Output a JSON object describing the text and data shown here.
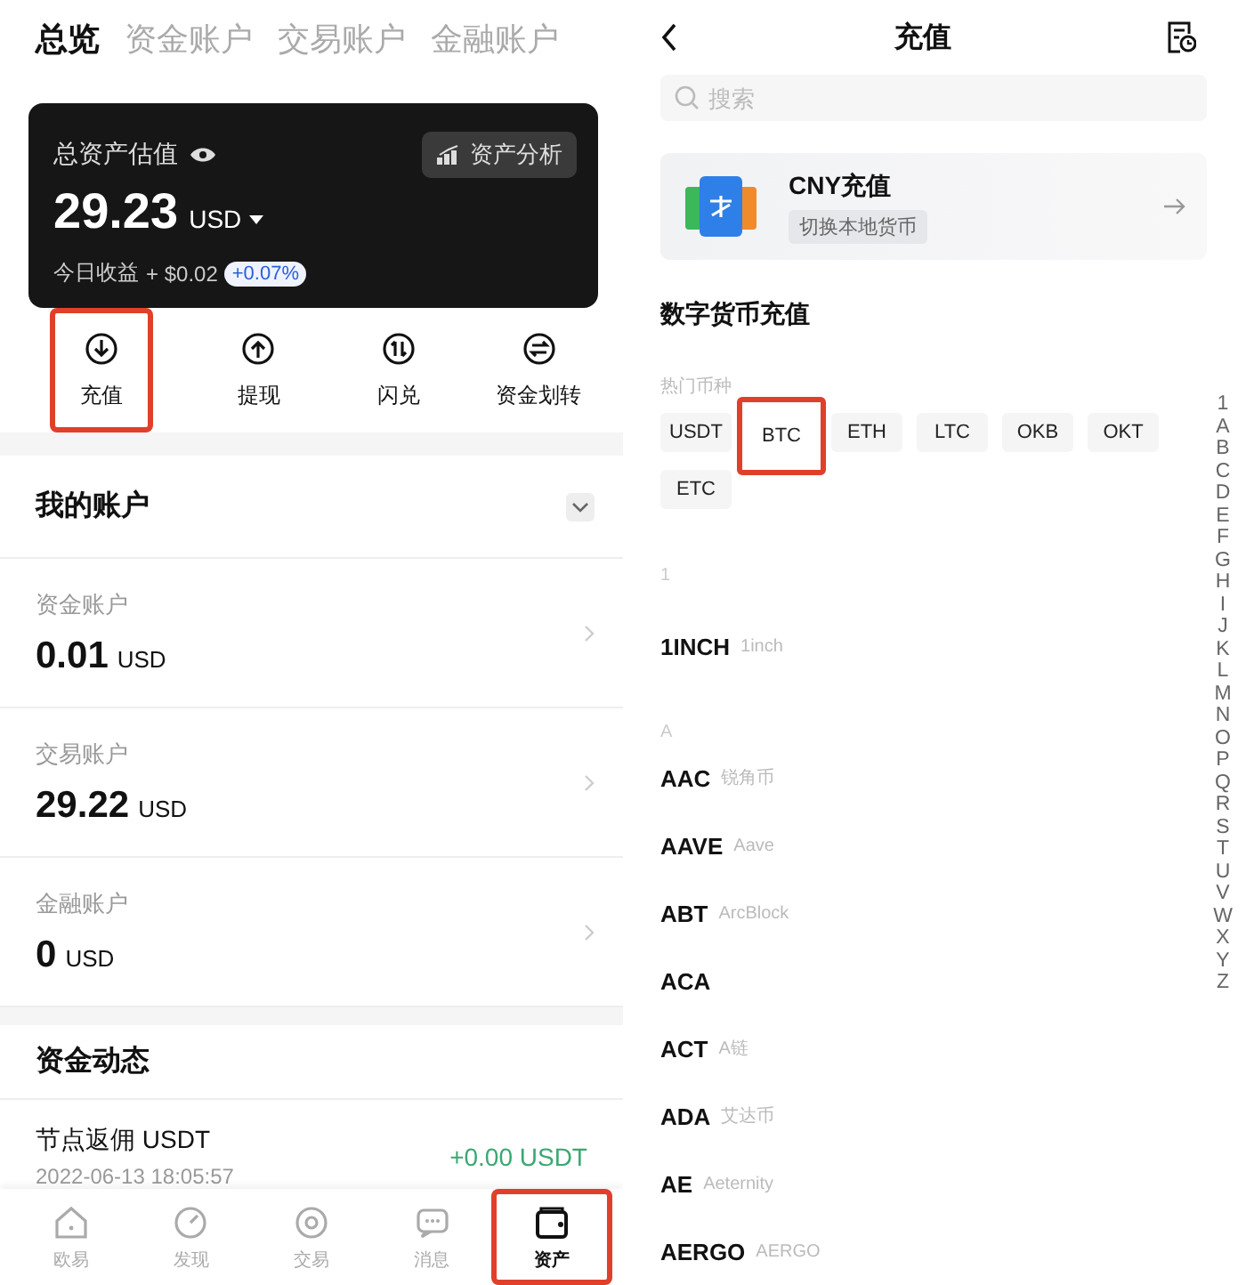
{
  "left": {
    "tabs": [
      {
        "label": "总览",
        "selected": true
      },
      {
        "label": "资金账户",
        "selected": false
      },
      {
        "label": "交易账户",
        "selected": false
      },
      {
        "label": "金融账户",
        "selected": false
      }
    ],
    "asset_card": {
      "title": "总资产估值",
      "value": "29.23",
      "unit": "USD",
      "analysis_button": "资产分析",
      "today_label": "今日收益",
      "today_value": "+ $0.02",
      "today_change": "+0.07%"
    },
    "actions": [
      {
        "label": "充值",
        "kind": "deposit",
        "highlighted": true
      },
      {
        "label": "提现",
        "kind": "withdraw",
        "highlighted": false
      },
      {
        "label": "闪兑",
        "kind": "swap",
        "highlighted": false
      },
      {
        "label": "资金划转",
        "kind": "transfer",
        "highlighted": false
      }
    ],
    "my_accounts": {
      "title": "我的账户",
      "accounts": [
        {
          "name": "资金账户",
          "value": "0.01",
          "unit": "USD"
        },
        {
          "name": "交易账户",
          "value": "29.22",
          "unit": "USD"
        },
        {
          "name": "金融账户",
          "value": "0",
          "unit": "USD"
        }
      ]
    },
    "fund_activity": {
      "title": "资金动态",
      "entries": [
        {
          "title": "节点返佣 USDT",
          "time": "2022-06-13 18:05:57",
          "amount": "+0.00 USDT"
        }
      ]
    },
    "bottom_nav": [
      {
        "label": "欧易",
        "kind": "home",
        "selected": false,
        "highlighted": false
      },
      {
        "label": "发现",
        "kind": "discover",
        "selected": false,
        "highlighted": false
      },
      {
        "label": "交易",
        "kind": "trade",
        "selected": false,
        "highlighted": false
      },
      {
        "label": "消息",
        "kind": "message",
        "selected": false,
        "highlighted": false
      },
      {
        "label": "资产",
        "kind": "wallet",
        "selected": true,
        "highlighted": true
      }
    ]
  },
  "right": {
    "header": {
      "title": "充值"
    },
    "search": {
      "placeholder": "搜索"
    },
    "cny_card": {
      "title": "CNY充值",
      "button": "切换本地货币"
    },
    "section_title": "数字货币充值",
    "hot_label": "热门币种",
    "hot_coins": [
      {
        "label": "USDT",
        "highlighted": false
      },
      {
        "label": "BTC",
        "highlighted": true
      },
      {
        "label": "ETH",
        "highlighted": false
      },
      {
        "label": "LTC",
        "highlighted": false
      },
      {
        "label": "OKB",
        "highlighted": false
      },
      {
        "label": "OKT",
        "highlighted": false
      },
      {
        "label": "ETC",
        "highlighted": false
      }
    ],
    "groups": [
      {
        "letter": "1",
        "coins": [
          {
            "symbol": "1INCH",
            "name": "1inch"
          }
        ]
      },
      {
        "letter": "A",
        "coins": [
          {
            "symbol": "AAC",
            "name": "锐角币"
          },
          {
            "symbol": "AAVE",
            "name": "Aave"
          },
          {
            "symbol": "ABT",
            "name": "ArcBlock"
          },
          {
            "symbol": "ACA"
          },
          {
            "symbol": "ACT",
            "name": "A链"
          },
          {
            "symbol": "ADA",
            "name": "艾达币"
          },
          {
            "symbol": "AE",
            "name": "Aeternity"
          },
          {
            "symbol": "AERGO",
            "name": "AERGO"
          }
        ]
      }
    ],
    "index_letters": [
      "1",
      "A",
      "B",
      "C",
      "D",
      "E",
      "F",
      "G",
      "H",
      "I",
      "J",
      "K",
      "L",
      "M",
      "N",
      "O",
      "P",
      "Q",
      "R",
      "S",
      "T",
      "U",
      "V",
      "W",
      "X",
      "Y",
      "Z"
    ]
  }
}
